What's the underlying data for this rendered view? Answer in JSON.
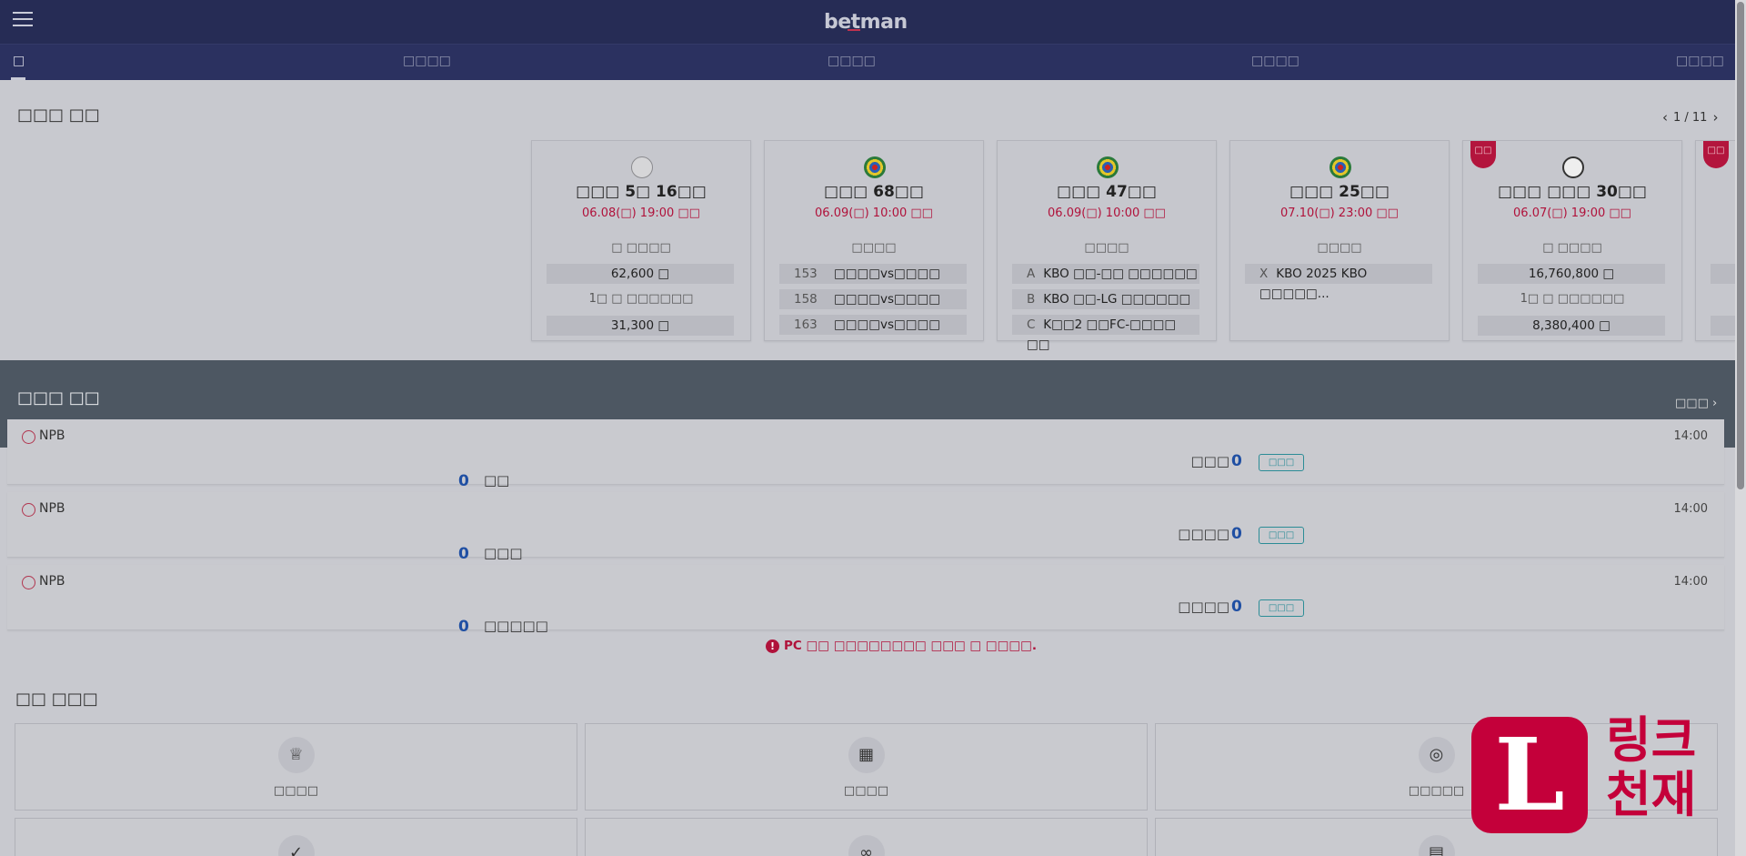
{
  "header": {
    "logo": "betman",
    "nav": {
      "home": "□",
      "items": [
        "□□□□",
        "□□□□",
        "□□□□",
        "□□□□"
      ]
    }
  },
  "section1": {
    "title": "□□□ □□",
    "pager": "1 / 11",
    "cards": [
      {
        "title": "□□□ 5□ 16□□",
        "date": "06.08(□) 19:00 □□",
        "sub1": "□ □□□□",
        "box1": "62,600 □",
        "sub2": "1□ □ □□□□□□",
        "box2": "31,300 □",
        "icon": "golf-icon"
      },
      {
        "title": "□□□ 68□□",
        "date": "06.09(□) 10:00 □□",
        "sub1": "□□□□",
        "rows": [
          {
            "num": "153",
            "text": "□□□□vs□□□□"
          },
          {
            "num": "158",
            "text": "□□□□vs□□□□"
          },
          {
            "num": "163",
            "text": "□□□□vs□□□□"
          }
        ],
        "icon": "target-icon"
      },
      {
        "title": "□□□ 47□□",
        "date": "06.09(□) 10:00 □□",
        "sub1": "□□□□",
        "rows": [
          {
            "num": "A",
            "text": "KBO □□-□□ □□□□□□"
          },
          {
            "num": "B",
            "text": "KBO □□-LG □□□□□□"
          },
          {
            "num": "C",
            "text": "K□□2 □□FC-□□□□ □□"
          }
        ],
        "icon": "target-icon"
      },
      {
        "title": "□□□ 25□□",
        "date": "07.10(□) 23:00 □□",
        "sub1": "□□□□",
        "rows": [
          {
            "num": "X",
            "text": "KBO 2025 KBO □□□□□..."
          }
        ],
        "icon": "target-icon"
      },
      {
        "title": "□□□ □□□ 30□□",
        "date": "06.07(□) 19:00 □□",
        "sub1": "□ □□□□",
        "box1": "16,760,800 □",
        "sub2": "1□ □ □□□□□□",
        "box2": "8,380,400 □",
        "icon": "soccer-icon",
        "badge": "□□"
      },
      {
        "badge": "□□"
      }
    ]
  },
  "section2": {
    "title": "□□□ □□",
    "more": "□□□",
    "live_label": "□□□",
    "matches": [
      {
        "league": "NPB",
        "time": "14:00",
        "home_score": "0",
        "home_team": "□□",
        "away_team": "□□□",
        "away_score": "0"
      },
      {
        "league": "NPB",
        "time": "14:00",
        "home_score": "0",
        "home_team": "□□□",
        "away_team": "□□□□",
        "away_score": "0"
      },
      {
        "league": "NPB",
        "time": "14:00",
        "home_score": "0",
        "home_team": "□□□□□",
        "away_team": "□□□□",
        "away_score": "0"
      }
    ],
    "notice": "PC □□ □□□□□□□□ □□□ □ □□□□."
  },
  "section3": {
    "title": "□□ □□□",
    "tiles": [
      {
        "label": "□□□□",
        "icon": "trophy-icon"
      },
      {
        "label": "□□□□",
        "icon": "calendar-icon"
      },
      {
        "label": "□□□□□",
        "icon": "basketball-icon"
      }
    ]
  },
  "watermark": {
    "letter": "L",
    "text": "링크천재"
  },
  "colors": {
    "header": "#262c55",
    "accent_red": "#b0123b",
    "score_blue": "#1f4fa3"
  }
}
